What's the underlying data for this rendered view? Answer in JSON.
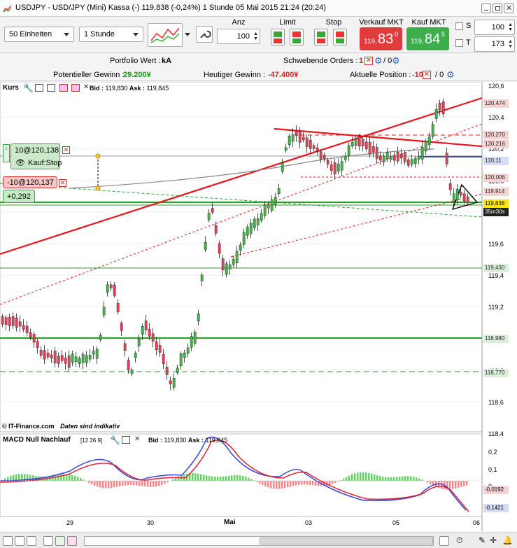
{
  "window": {
    "title": "USDJPY - USD/JPY (Mini) Kassa (-)   119,838 (-0,24%)   1 Stunde   05 Mai 2015 21:24 (20:24)"
  },
  "toolbar": {
    "units_value": "50 Einheiten",
    "interval_value": "1 Stunde",
    "anz_label": "Anz",
    "anz_value": "100",
    "limit_label": "Limit",
    "stop_label": "Stop",
    "sell_label": "Verkauf MKT",
    "buy_label": "Kauf MKT",
    "sell_small": "119,",
    "sell_big": "83",
    "sell_sup": "0",
    "buy_small": "119,",
    "buy_big": "84",
    "buy_sup": "5",
    "s_label": "S",
    "s_value": "100",
    "t_label": "T",
    "t_value": "173"
  },
  "info": {
    "portfolio_label": "Portfolio Wert :",
    "portfolio_value": "kA",
    "pending_label": "Schwebende Orders :",
    "pending_value": "1",
    "pending_zero": "/ 0",
    "potential_label": "Potentieller Gewinn :",
    "potential_value": "29.200¥",
    "today_label": "Heutiger Gewinn :",
    "today_value": "-47.400¥",
    "position_label": "Aktuelle Position :",
    "position_value": "-10",
    "position_zero": "/ 0"
  },
  "chart_header": {
    "name": "Kurs",
    "bid_label": "Bid :",
    "bid_value": "119,830",
    "ask_label": "Ask :",
    "ask_value": "119,845"
  },
  "orders": {
    "order1": "10@120,138",
    "order1_type": "Kauf:Stop",
    "order2": "-10@120,137",
    "profit": "+0,292"
  },
  "price_axis": {
    "ticks": [
      "120,6",
      "120,4",
      "120,2",
      "120,0",
      "119,8",
      "119,6",
      "119,4",
      "119,2",
      "119,0",
      "118,8",
      "118,6",
      "118,4"
    ],
    "tags": [
      {
        "text": "120,474",
        "color": "#f6d3d3",
        "fg": "#222"
      },
      {
        "text": "120,270",
        "color": "#f6d3d3",
        "fg": "#222"
      },
      {
        "text": "120,216",
        "color": "#f6d3d3",
        "fg": "#222"
      },
      {
        "text": "120,11",
        "color": "#d7dcf5",
        "fg": "#222"
      },
      {
        "text": "120,006",
        "color": "#f6d3d3",
        "fg": "#222"
      },
      {
        "text": "119,914",
        "color": "#f6d3d3",
        "fg": "#222"
      },
      {
        "text": "119,838",
        "color": "#ffe600",
        "fg": "#000"
      },
      {
        "text": "35m30s",
        "color": "#1f1f1f",
        "fg": "#fff"
      },
      {
        "text": "119,430",
        "color": "#d9efd9",
        "fg": "#222"
      },
      {
        "text": "118,980",
        "color": "#d9efd9",
        "fg": "#222"
      },
      {
        "text": "118,770",
        "color": "#d9efd9",
        "fg": "#222"
      }
    ]
  },
  "footer_note": {
    "brand": "© IT-Finance.com",
    "note": "Daten sind indikativ"
  },
  "macd": {
    "name": "MACD Null Nachlauf",
    "params": "[12 26 9]",
    "bid_label": "Bid :",
    "bid_value": "119,830",
    "ask_label": "Ask :",
    "ask_value": "119,845",
    "ticks": [
      "0,2",
      "0,1",
      "0"
    ],
    "tag1": "-0,0192",
    "tag2": "-0,1421"
  },
  "time_axis": {
    "labels": [
      "29",
      "30",
      "Mai",
      "03",
      "05",
      "06"
    ]
  },
  "colors": {
    "sell": "#e03c3c",
    "buy": "#3cae4c",
    "trend_red": "#e8161c",
    "support_green": "#2aa02a",
    "candle_up": "#43b34a",
    "candle_down": "#e0435a"
  }
}
